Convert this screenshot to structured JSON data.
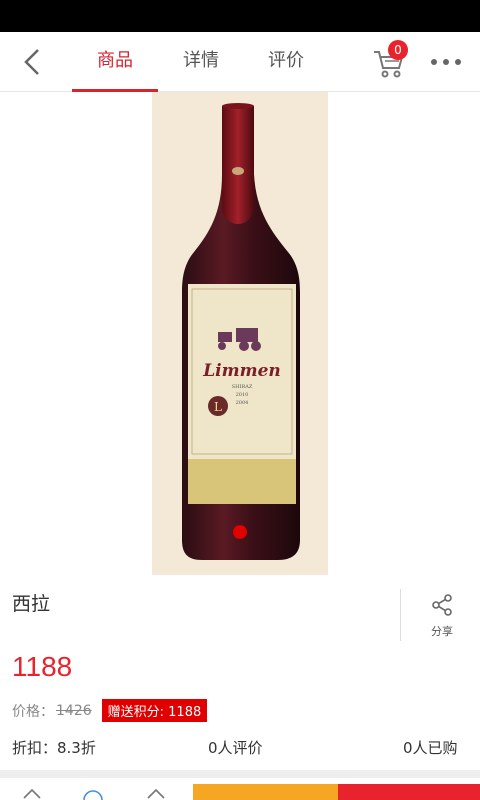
{
  "nav": {
    "tabs": [
      "商品",
      "详情",
      "评价"
    ],
    "active_tab": 0,
    "cart_count": "0"
  },
  "product": {
    "name": "西拉",
    "price": "1188",
    "original_price_label": "价格：",
    "original_price": "1426",
    "points_badge": "赠送积分: 1188",
    "discount": "折扣：8.3折",
    "reviews": "0人评价",
    "sold": "0人已购",
    "share_label": "分享",
    "bottle_label": {
      "brand": "Limmen",
      "variety": "SHIRAZ",
      "line1": "2010",
      "line2": "2004",
      "monogram": "L"
    }
  },
  "colors": {
    "accent": "#d9232d",
    "orange": "#f5a623"
  }
}
